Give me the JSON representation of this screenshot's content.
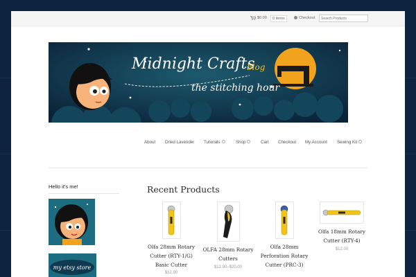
{
  "topbar": {
    "cart_amount": "$0.00",
    "cart_count": "0 items",
    "checkout_label": "Checkout",
    "search_placeholder": "Search Products"
  },
  "banner": {
    "title": "Midnight Crafts",
    "blog_label": "blog",
    "subtitle": "the stitching hour"
  },
  "nav": {
    "items": [
      {
        "label": "About"
      },
      {
        "label": "Dried Lavender"
      },
      {
        "label": "Tutorials"
      },
      {
        "label": "Shop"
      },
      {
        "label": "Cart"
      },
      {
        "label": "Checkout"
      },
      {
        "label": "My Account"
      },
      {
        "label": "Sewing Kit"
      }
    ]
  },
  "sidebar": {
    "title": "Hello it's me!",
    "etsy_label": "my etsy store"
  },
  "main": {
    "section_title": "Recent Products",
    "products": [
      {
        "name": "Olfa 28mm Rotary Cutter (RTY-1/G) Basic Cutter",
        "price": "$12.90"
      },
      {
        "name": "OLFA 28mm Rotary Cutters",
        "price": "$12.90–$20.00"
      },
      {
        "name": "Olfa 28mm Perforation Rotary Cutter (PRC-3)",
        "price": ""
      },
      {
        "name": "Olfa 18mm Rotary Cutter (RTY-4)",
        "price": "$12.00"
      }
    ]
  },
  "colors": {
    "background": "#0d2340",
    "banner_bg": "#0f3a4f",
    "moon": "#f2a31d",
    "accent_yellow": "#f0c419"
  }
}
